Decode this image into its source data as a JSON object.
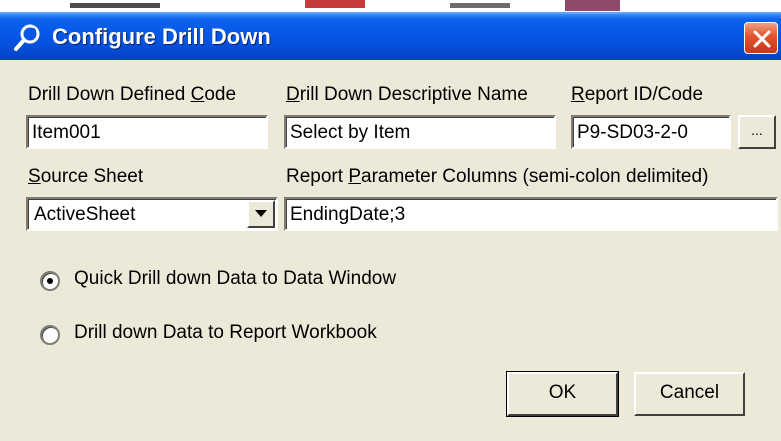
{
  "window": {
    "title": "Configure Drill Down",
    "title_icon": "wrench-icon",
    "close_icon": "close-icon"
  },
  "fields": {
    "defined_code": {
      "label_pre": "Drill Down Defined ",
      "label_key": "C",
      "label_post": "ode",
      "value": "Item001"
    },
    "descriptive_name": {
      "label_pre": "",
      "label_key": "D",
      "label_post": "rill Down Descriptive Name",
      "value": "Select by Item"
    },
    "report_id": {
      "label_pre": "",
      "label_key": "R",
      "label_post": "eport ID/Code",
      "value": "P9-SD03-2-0",
      "browse_label": "..."
    },
    "source_sheet": {
      "label_pre": "",
      "label_key": "S",
      "label_post": "ource Sheet",
      "value": "ActiveSheet"
    },
    "parameter_columns": {
      "label_pre": "Report ",
      "label_key": "P",
      "label_post": "arameter Columns (semi-colon delimited)",
      "value": "EndingDate;3"
    }
  },
  "options": {
    "quick_drill": {
      "label": "Quick Drill down Data to Data Window",
      "selected": true
    },
    "report_workbook": {
      "label": "Drill down Data to Report Workbook",
      "selected": false
    }
  },
  "buttons": {
    "ok_label": "OK",
    "cancel_label": "Cancel"
  },
  "colors": {
    "titlebar": "#0654e3",
    "dialog_bg": "#ece9d8",
    "close_button": "#e2522c"
  }
}
